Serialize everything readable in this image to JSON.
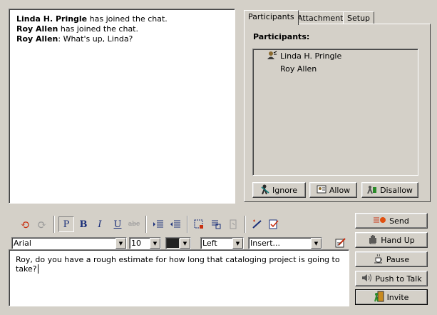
{
  "chat": {
    "messages": [
      {
        "sender": "Linda H. Pringle",
        "text": " has joined the chat."
      },
      {
        "sender": "Roy Allen",
        "text": " has joined the chat."
      },
      {
        "sender": "Roy Allen",
        "text": ": What's up, Linda?"
      }
    ]
  },
  "tabs": [
    "Participants",
    "Attachments",
    "Setup"
  ],
  "participants_panel": {
    "label": "Participants:",
    "people": [
      "Linda H. Pringle",
      "Roy Allen"
    ],
    "buttons": {
      "ignore": "Ignore",
      "allow": "Allow",
      "disallow": "Disallow"
    }
  },
  "format": {
    "font": "Arial",
    "size": "10",
    "color": "#222222",
    "align": "Left",
    "insert": "Insert..."
  },
  "compose": {
    "text": "Roy, do you have a rough estimate for how long that cataloging project is going to take?"
  },
  "actions": {
    "send": "Send",
    "hand_up": "Hand Up",
    "pause": "Pause",
    "push_to_talk": "Push to Talk",
    "invite": "Invite"
  }
}
